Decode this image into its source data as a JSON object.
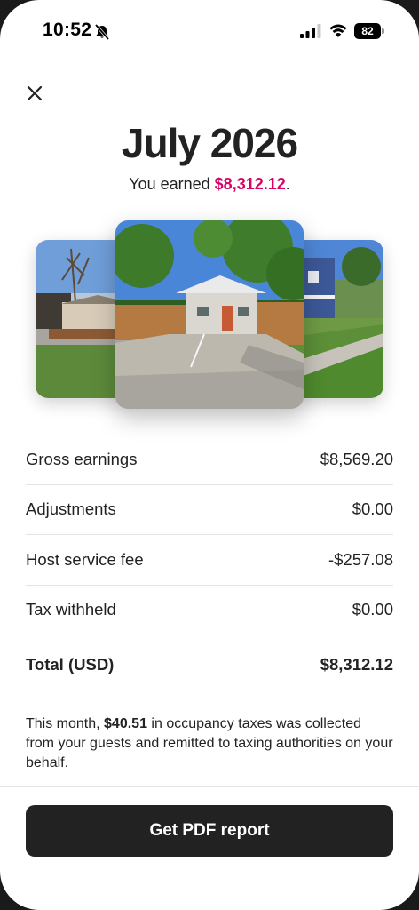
{
  "status_bar": {
    "time": "10:52",
    "battery": "82"
  },
  "header": {
    "title": "July 2026",
    "subtitle_prefix": "You earned ",
    "subtitle_amount": "$8,312.12",
    "subtitle_suffix": "."
  },
  "earnings": [
    {
      "label": "Gross earnings",
      "value": "$8,569.20"
    },
    {
      "label": "Adjustments",
      "value": "$0.00"
    },
    {
      "label": "Host service fee",
      "value": "-$257.08"
    },
    {
      "label": "Tax withheld",
      "value": "$0.00"
    }
  ],
  "total": {
    "label": "Total (USD)",
    "value": "$8,312.12"
  },
  "note": {
    "prefix": "This month, ",
    "amount": "$40.51",
    "suffix": " in occupancy taxes was collected from your guests and remitted to taxing authorities on your behalf."
  },
  "actions": {
    "pdf_button": "Get PDF report"
  },
  "colors": {
    "accent": "#d70466",
    "button_bg": "#222222"
  },
  "icons": [
    "bell-slash-icon",
    "signal-icon",
    "wifi-icon",
    "battery-icon",
    "close-icon"
  ]
}
